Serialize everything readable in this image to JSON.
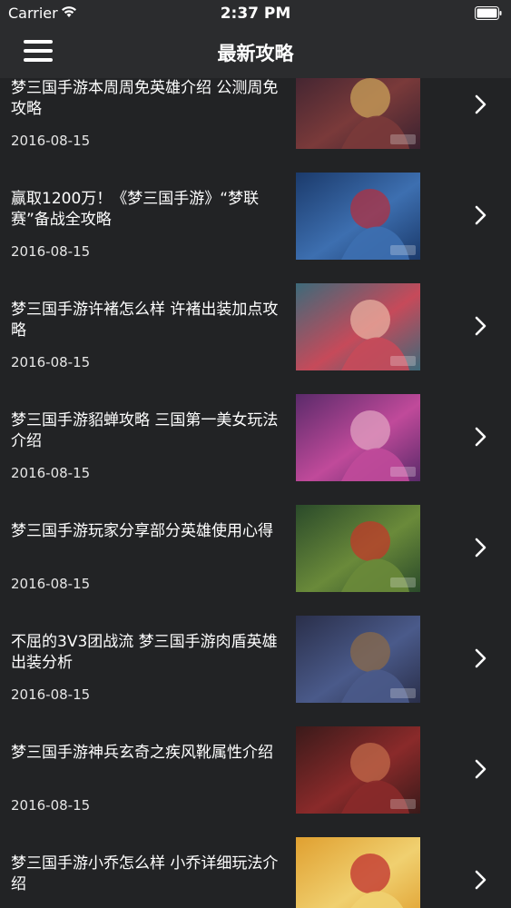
{
  "status_bar": {
    "carrier": "Carrier",
    "time": "2:37 PM"
  },
  "nav": {
    "title": "最新攻略",
    "menu_icon": "hamburger-menu-icon"
  },
  "articles": [
    {
      "title": "梦三国手游本周周免英雄介绍 公测周免攻略",
      "date": "2016-08-15",
      "thumb_colors": [
        "#3a2230",
        "#7a3a3a",
        "#c9a15a"
      ]
    },
    {
      "title": "赢取1200万！《梦三国手游》“梦联赛”备战全攻略",
      "date": "2016-08-15",
      "thumb_colors": [
        "#1b3a6b",
        "#3d6fb0",
        "#b03040"
      ]
    },
    {
      "title": "梦三国手游许褚怎么样 许褚出装加点攻略",
      "date": "2016-08-15",
      "thumb_colors": [
        "#3d6a7a",
        "#c64a5a",
        "#e8b0a0"
      ]
    },
    {
      "title": "梦三国手游貂蝉攻略 三国第一美女玩法介绍",
      "date": "2016-08-15",
      "thumb_colors": [
        "#5a2a6a",
        "#c04a9a",
        "#e0a0c0"
      ]
    },
    {
      "title": "梦三国手游玩家分享部分英雄使用心得",
      "date": "2016-08-15",
      "thumb_colors": [
        "#2a4a2a",
        "#6a8a3a",
        "#c03a2a"
      ]
    },
    {
      "title": "不屈的3V3团战流 梦三国手游肉盾英雄出装分析",
      "date": "2016-08-15",
      "thumb_colors": [
        "#2a2f4a",
        "#4a5a8a",
        "#8a6a4a"
      ]
    },
    {
      "title": "梦三国手游神兵玄奇之疾风靴属性介绍",
      "date": "2016-08-15",
      "thumb_colors": [
        "#3a1a1a",
        "#8a2a2a",
        "#c06a4a"
      ]
    },
    {
      "title": "梦三国手游小乔怎么样 小乔详细玩法介绍",
      "date": "",
      "thumb_colors": [
        "#e0a030",
        "#f0d070",
        "#c03030"
      ]
    }
  ]
}
